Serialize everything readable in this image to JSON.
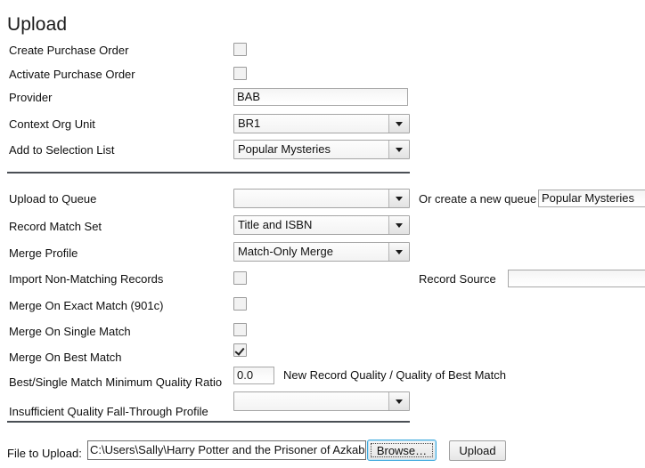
{
  "page": {
    "title": "Upload"
  },
  "section_one": {
    "rows": [
      {
        "label": "Create Purchase Order",
        "control": "checkbox",
        "checked": false
      },
      {
        "label": "Activate Purchase Order",
        "control": "checkbox",
        "checked": false
      },
      {
        "label": "Provider",
        "control": "text",
        "value": "BAB"
      },
      {
        "label": "Context Org Unit",
        "control": "select",
        "value": "BR1"
      },
      {
        "label": "Add to Selection List",
        "control": "select",
        "value": "Popular Mysteries"
      }
    ]
  },
  "section_two": {
    "rows": [
      {
        "label": "Upload to Queue",
        "control": "select",
        "value": ""
      },
      {
        "label": "Record Match Set",
        "control": "select",
        "value": "Title and ISBN"
      },
      {
        "label": "Merge Profile",
        "control": "select",
        "value": "Match-Only Merge"
      },
      {
        "label": "Import Non-Matching Records",
        "control": "checkbox",
        "checked": false
      },
      {
        "label": "Merge On Exact Match (901c)",
        "control": "checkbox",
        "checked": false
      },
      {
        "label": "Merge On Single Match",
        "control": "checkbox",
        "checked": false
      },
      {
        "label": "Merge On Best Match",
        "control": "checkbox",
        "checked": true
      },
      {
        "label": "Best/Single Match Minimum Quality Ratio",
        "control": "text",
        "value": "0.0"
      },
      {
        "label": "Insufficient Quality Fall-Through Profile",
        "control": "select",
        "value": ""
      }
    ],
    "new_queue_label": "Or create a new queue",
    "new_queue_value": "Popular Mysteries",
    "record_source_label": "Record Source",
    "record_source_value": "",
    "quality_ratio_hint": "New Record Quality / Quality of Best Match"
  },
  "file_row": {
    "label": "File to Upload:",
    "path_value": "C:\\Users\\Sally\\Harry Potter and the Prisoner of Azkab",
    "browse_label": "Browse…",
    "upload_label": "Upload"
  },
  "icons": {
    "dropdown": "chevron-down-icon",
    "check": "checkmark-icon"
  },
  "colors": {
    "focus_border": "#3fa9dd",
    "divider": "#4a4f55",
    "text": "#111111",
    "input_border": "#a8a8a8"
  }
}
